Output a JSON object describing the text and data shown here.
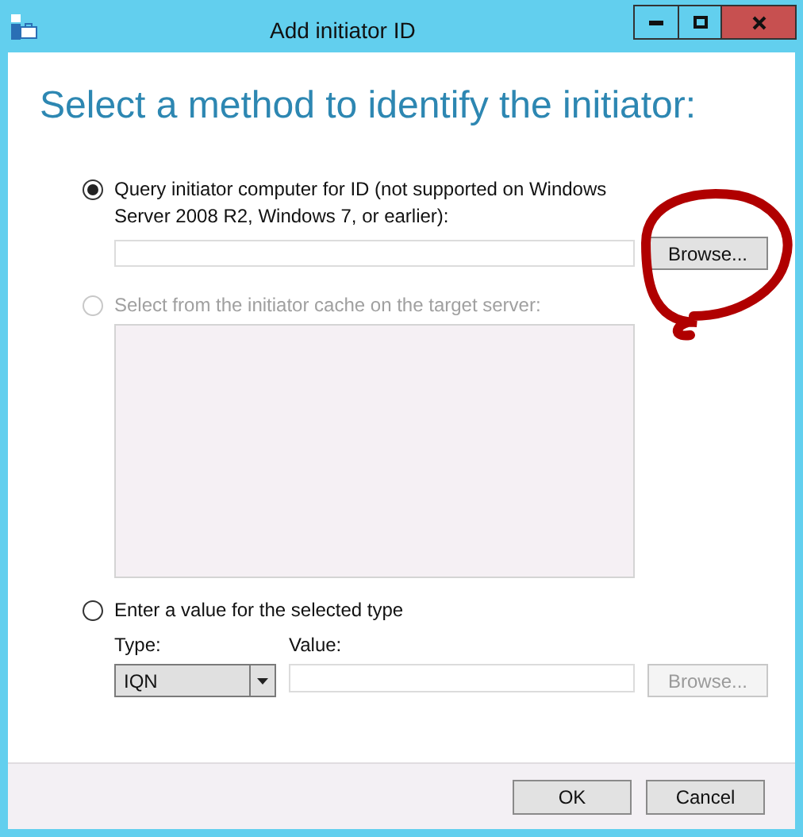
{
  "window": {
    "title": "Add initiator ID"
  },
  "heading": "Select a method to identify the initiator:",
  "options": [
    {
      "kind": "query",
      "label": "Query initiator computer for ID (not supported on Windows Server 2008 R2, Windows 7, or earlier):",
      "selected": true,
      "disabled": false,
      "browse_button": {
        "label": "Browse...",
        "disabled": false
      }
    },
    {
      "kind": "cache",
      "label": "Select from the initiator cache on the target server:",
      "selected": false,
      "disabled": true
    },
    {
      "kind": "manual",
      "label": "Enter a value for the selected type",
      "selected": false,
      "disabled": false,
      "type_label": "Type:",
      "type_value": "IQN",
      "value_label": "Value:",
      "browse_button": {
        "label": "Browse...",
        "disabled": true
      }
    }
  ],
  "buttons": [
    {
      "label": "OK"
    },
    {
      "label": "Cancel"
    }
  ]
}
